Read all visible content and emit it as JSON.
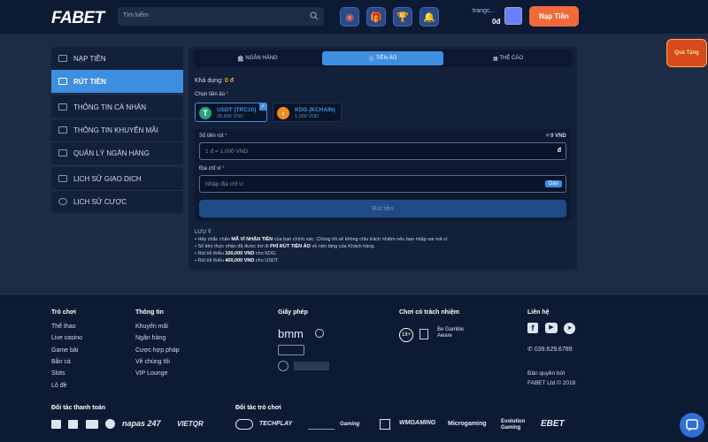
{
  "header": {
    "logo": "FABET",
    "search_placeholder": "Tìm kiếm",
    "username": "trangc...",
    "balance": "0đ",
    "deposit_button": "Nạp Tiền",
    "promo_badge": "Quà Tặng"
  },
  "sidebar": {
    "group1": [
      "NẠP TIỀN",
      "RÚT TIỀN"
    ],
    "group2": [
      "THÔNG TIN CÁ NHÂN",
      "THÔNG TIN KHUYẾN MÃI",
      "QUẢN LÝ NGÂN HÀNG"
    ],
    "group3": [
      "LỊCH SỬ GIAO DỊCH",
      "LỊCH SỬ CƯỢC"
    ]
  },
  "tabs": [
    "NGÂN HÀNG",
    "TIỀN ẢO",
    "THẺ CÀO"
  ],
  "form": {
    "available_label": "Khả dụng:",
    "available_value": "0 đ",
    "choose_coin_label": "Chọn tiền ảo",
    "coins": [
      {
        "name": "USDT (TRC20)",
        "limit": "25,906 VND"
      },
      {
        "name": "KDG (KCHAIN)",
        "limit": "1,000 VND"
      }
    ],
    "amount_label": "Số tiền rút",
    "amount_right": "= 0 VND",
    "amount_placeholder": "1 đ = 1,000 VND",
    "amount_unit": "đ",
    "wallet_label": "Địa chỉ ví",
    "wallet_placeholder": "Nhập địa chỉ ví",
    "paste_button": "Dán",
    "submit_button": "Rút tiền",
    "required": "*"
  },
  "notes": {
    "title": "LƯU Ý:",
    "n1a": "• Hãy chắc chắn ",
    "n1b": "MÃ VÍ NHẬN TIỀN",
    "n1c": " của bạn chính xác. Chúng tôi sẽ không chịu trách nhiệm nếu bạn nhập sai mã ví.",
    "n2a": "• Số tiền thực nhận đã được trừ đi ",
    "n2b": "PHÍ RÚT TIỀN ẢO",
    "n2c": " về nền tảng của Khách hàng.",
    "n3a": "• Rút tối thiểu ",
    "n3b": "100,000 VND",
    "n3c": " cho KDG.",
    "n4a": "• Rút tối thiểu ",
    "n4b": "400,000 VND",
    "n4c": " cho USDT."
  },
  "footer": {
    "games_title": "Trò chơi",
    "games": [
      "Thể thao",
      "Live casino",
      "Game bài",
      "Bắn cá",
      "Slots",
      "Lô đề"
    ],
    "info_title": "Thông tin",
    "info": [
      "Khuyến mãi",
      "Ngân hàng",
      "Cược hợp pháp",
      "Về chúng tôi",
      "VIP Lounge"
    ],
    "license_title": "Giấy phép",
    "license_logo": "bmm",
    "responsible_title": "Chơi có trách nhiệm",
    "age": "18+",
    "begamble": "Be Gamble Aware",
    "contact_title": "Liên hệ",
    "phone": "039.629.6789",
    "copyright1": "Bản quyền bởi",
    "copyright2": "FABET Ltd © 2018",
    "payment_title": "Đối tác thanh toán",
    "payment_partners": [
      "napas 247",
      "VIETQR"
    ],
    "game_partners_title": "Đối tác trò chơi",
    "game_partners": [
      "TECHPLAY",
      "Gaming",
      "WMGAMING",
      "Microgaming",
      "Evolution Gaming",
      "EBET"
    ]
  },
  "colors": {
    "accent": "#3f8fe0",
    "deposit": "#f26a3a",
    "balance_orange": "#f5a623"
  }
}
